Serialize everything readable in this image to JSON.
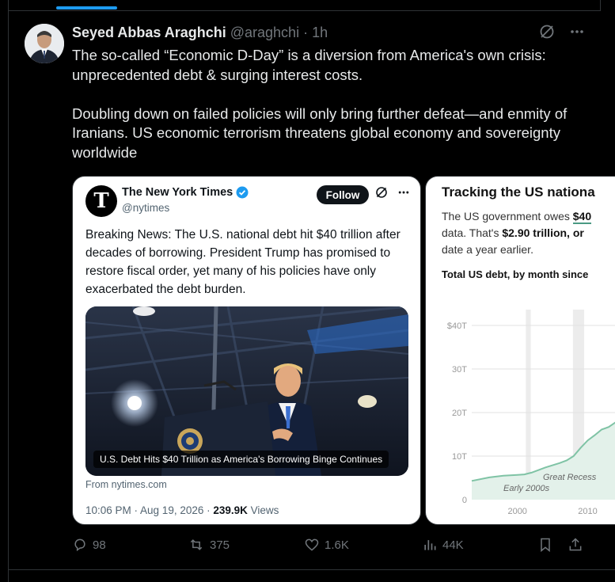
{
  "author": {
    "name": "Seyed Abbas Araghchi",
    "handle": "@araghchi",
    "time": "1h",
    "separator": "·"
  },
  "tweet": {
    "paragraph1": "The so-called “Economic D-Day” is a diversion from America's own crisis: unprecedented debt & surging interest costs.",
    "paragraph2": "Doubling down on failed policies will only bring further defeat—and enmity of Iranians. US economic terrorism threatens global economy and sovereignty worldwide"
  },
  "nyt_card": {
    "name": "The New York Times",
    "handle": "@nytimes",
    "follow_label": "Follow",
    "text": "Breaking News: The U.S. national debt hit $40 trillion after decades of borrowing. President Trump has promised to restore fiscal order, yet many of his policies have only exacerbated the debt burden.",
    "photo_caption": "U.S. Debt Hits $40 Trillion as America's Borrowing Binge Continues",
    "from_link": "From nytimes.com",
    "timestamp": "10:06 PM · Aug 19, 2026 · ",
    "views_count": "239.9K",
    "views_label": " Views"
  },
  "chart_card": {
    "title": "Tracking the US nationa",
    "desc_part1": "The US government owes ",
    "desc_amount": "$40",
    "desc_part2": "data. That's ",
    "desc_bold": "$2.90 trillion, or",
    "desc_part3": "date a year earlier.",
    "subtitle": "Total US debt, by month since",
    "annotations": {
      "early": "Early 2000s",
      "great": "Great Recess"
    }
  },
  "chart_data": {
    "type": "area",
    "ylabel": "",
    "xlabel": "",
    "yticks": [
      "$40T",
      "30T",
      "20T",
      "10T",
      "0"
    ],
    "xticks": [
      "2000",
      "2010"
    ],
    "ylim": [
      0,
      40
    ],
    "xlim": [
      1993.5,
      2014
    ],
    "grid": true,
    "x": [
      1993.5,
      1996,
      1998,
      2000,
      2001,
      2002,
      2004,
      2006,
      2007,
      2008,
      2009,
      2010,
      2011,
      2012,
      2013,
      2014
    ],
    "values": [
      4.3,
      5.1,
      5.5,
      5.7,
      5.8,
      6.2,
      7.4,
      8.4,
      9.0,
      10.0,
      11.9,
      13.6,
      14.8,
      16.1,
      16.7,
      17.8
    ],
    "shaded_periods": [
      [
        2001.2,
        2001.9
      ],
      [
        2007.9,
        2009.5
      ]
    ],
    "colors": {
      "line": "#7fc3a5",
      "area": "#e3f1ea",
      "shade": "#ececec"
    }
  },
  "actions": {
    "replies": "98",
    "reposts": "375",
    "likes": "1.6K",
    "views": "44K"
  }
}
